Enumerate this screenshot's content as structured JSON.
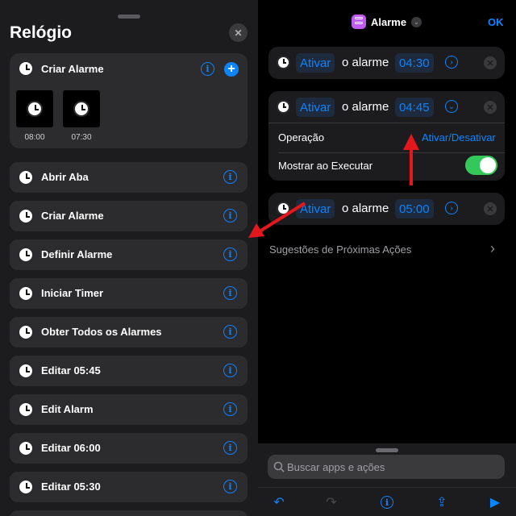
{
  "left_panel": {
    "title": "Relógio",
    "close_glyph": "✕",
    "featured": {
      "label": "Criar Alarme",
      "info_glyph": "i",
      "add_glyph": "+",
      "tiles": [
        "08:00",
        "07:30"
      ]
    },
    "actions": [
      {
        "label": "Abrir Aba"
      },
      {
        "label": "Criar Alarme"
      },
      {
        "label": "Definir Alarme"
      },
      {
        "label": "Iniciar Timer"
      },
      {
        "label": "Obter Todos os Alarmes"
      },
      {
        "label": "Editar 05:45"
      },
      {
        "label": "Edit Alarm"
      },
      {
        "label": "Editar 06:00"
      },
      {
        "label": "Editar 05:30"
      }
    ],
    "info_glyph": "i"
  },
  "editor": {
    "header_title": "Alarme",
    "header_icon": "shortcut-layers-icon",
    "header_chevron": "⌄",
    "ok_label": "OK",
    "actions": [
      {
        "verb": "Ativar",
        "text": "o alarme",
        "time": "04:30",
        "chevron": "›",
        "expanded": false
      },
      {
        "verb": "Ativar",
        "text": "o alarme",
        "time": "04:45",
        "chevron": "⌄",
        "expanded": true,
        "operation_label": "Operação",
        "operation_value": "Ativar/Desativar",
        "show_label": "Mostrar ao Executar",
        "show_on": true
      },
      {
        "verb": "Ativar",
        "text": "o alarme",
        "time": "05:00",
        "chevron": "›",
        "expanded": false
      }
    ],
    "x_glyph": "✕",
    "suggestions": "Sugestões de Próximas Ações",
    "suggestions_chevron": "›",
    "search_placeholder": "Buscar apps e ações",
    "toolbar": {
      "undo_glyph": "↶",
      "redo_glyph": "↷",
      "info_glyph": "i",
      "share_glyph": "⇪",
      "play_glyph": "▶"
    }
  },
  "colors": {
    "accent": "#0a84ff",
    "toggle_on": "#34c759",
    "annotation_arrow": "#e3171c",
    "shortcut_icon": "#bf5af2"
  }
}
